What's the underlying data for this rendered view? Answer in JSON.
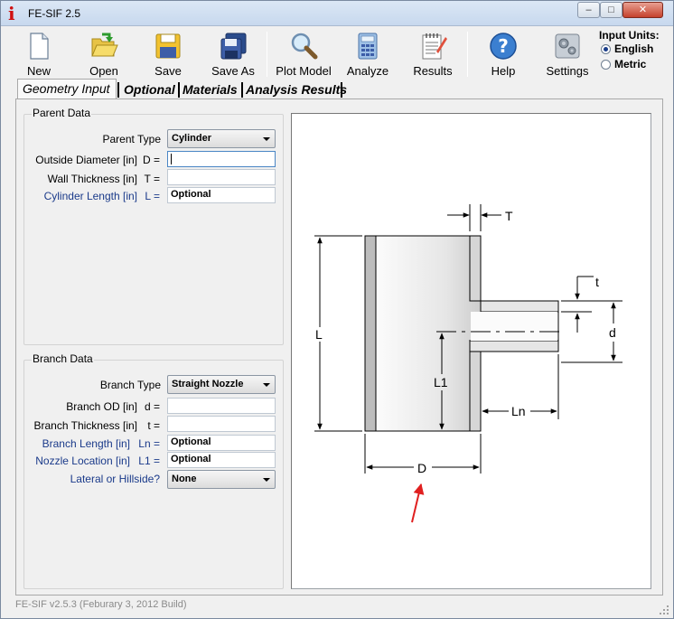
{
  "window": {
    "title": "FE-SIF 2.5",
    "app_icon": "i",
    "minimize": "–",
    "maximize": "□",
    "close": "✕"
  },
  "toolbar": {
    "new": "New",
    "open": "Open",
    "save": "Save",
    "save_as": "Save As",
    "plot_model": "Plot Model",
    "analyze": "Analyze",
    "results": "Results",
    "help": "Help",
    "settings": "Settings"
  },
  "units": {
    "title": "Input Units:",
    "english": "English",
    "metric": "Metric",
    "selected": "English"
  },
  "tabs": [
    "Geometry Input",
    "Optional",
    "Materials",
    "Analysis Results"
  ],
  "parent": {
    "title": "Parent Data",
    "type_label": "Parent Type",
    "type_value": "Cylinder",
    "od_label": "Outside Diameter [in]",
    "od_sym": "D =",
    "od_value": "",
    "wt_label": "Wall Thickness [in]",
    "wt_sym": "T =",
    "wt_value": "",
    "len_label": "Cylinder Length [in]",
    "len_sym": "L =",
    "len_value": "Optional"
  },
  "branch": {
    "title": "Branch Data",
    "type_label": "Branch Type",
    "type_value": "Straight Nozzle",
    "od_label": "Branch OD [in]",
    "od_sym": "d =",
    "od_value": "",
    "th_label": "Branch Thickness [in]",
    "th_sym": "t =",
    "th_value": "",
    "len_label": "Branch Length [in]",
    "len_sym": "Ln =",
    "len_value": "Optional",
    "loc_label": "Nozzle Location [in]",
    "loc_sym": "L1 =",
    "loc_value": "Optional",
    "lat_label": "Lateral or Hillside?",
    "lat_value": "None"
  },
  "diagram": {
    "T": "T",
    "t": "t",
    "L": "L",
    "d": "d",
    "L1": "L1",
    "Ln": "Ln",
    "D": "D"
  },
  "status": "FE-SIF v2.5.3  (Feburary 3, 2012 Build)",
  "colors": {
    "accent_blue": "#1a3a8a",
    "arrow_red": "#e02020"
  }
}
